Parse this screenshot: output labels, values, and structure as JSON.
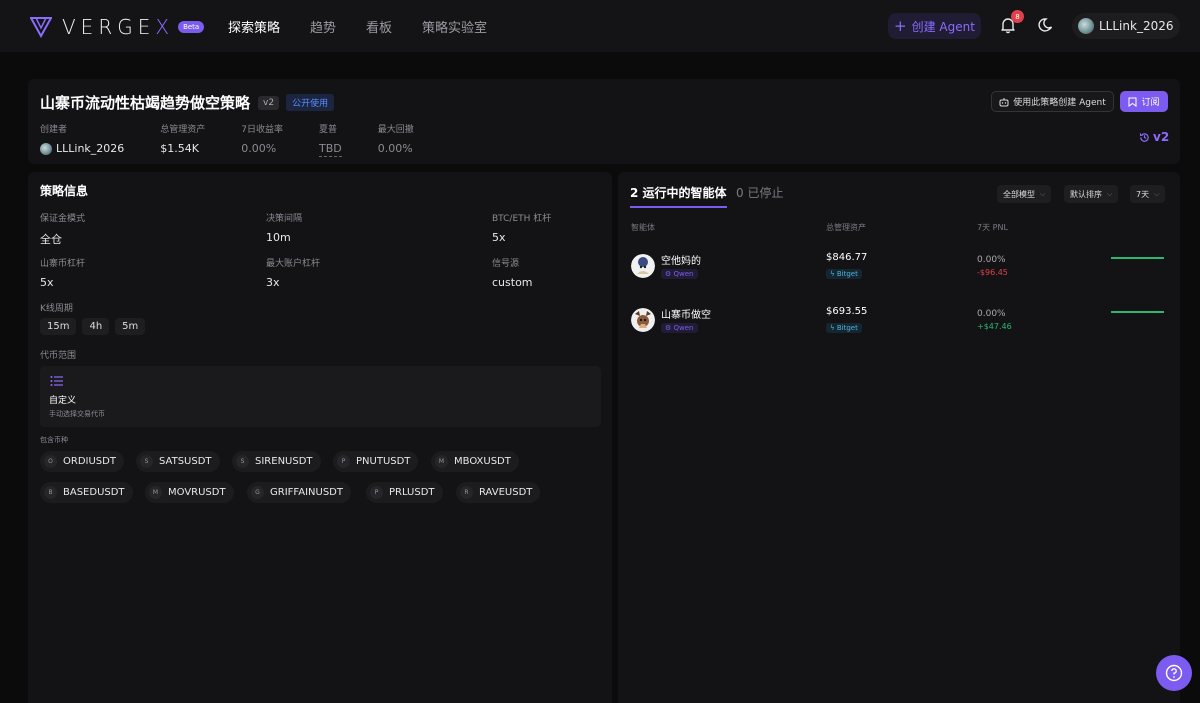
{
  "brand": {
    "name_main": "VERGE",
    "name_accent": "X",
    "beta": "Beta",
    "accent_color": "#7c5cf0"
  },
  "nav": {
    "items": [
      {
        "label": "探索策略",
        "active": true
      },
      {
        "label": "趋势",
        "active": false
      },
      {
        "label": "看板",
        "active": false
      },
      {
        "label": "策略实验室",
        "active": false
      }
    ],
    "create_agent": "创建 Agent",
    "notification_count": "8",
    "username": "LLLink_2026"
  },
  "strategy": {
    "title": "山寨币流动性枯竭趋势做空策略",
    "version": "v2",
    "visibility": "公开使用",
    "stats": [
      {
        "label": "创建者",
        "value": "LLLink_2026"
      },
      {
        "label": "总管理资产",
        "value": "$1.54K"
      },
      {
        "label": "7日收益率",
        "value": "0.00%"
      },
      {
        "label": "夏普",
        "value": "TBD"
      },
      {
        "label": "最大回撤",
        "value": "0.00%"
      }
    ],
    "create_from_button": "使用此策略创建 Agent",
    "subscribe_button": "订阅",
    "version_history": "v2"
  },
  "info": {
    "section_title": "策略信息",
    "fields": [
      {
        "label": "保证金模式",
        "value": "全仓"
      },
      {
        "label": "决策间隔",
        "value": "10m"
      },
      {
        "label": "BTC/ETH 杠杆",
        "value": "5x"
      },
      {
        "label": "山寨币杠杆",
        "value": "5x"
      },
      {
        "label": "最大账户杠杆",
        "value": "3x"
      },
      {
        "label": "信号源",
        "value": "custom"
      }
    ],
    "kline_label": "K线周期",
    "klines": [
      "15m",
      "4h",
      "5m"
    ],
    "coin_range_label": "代币范围",
    "custom_title": "自定义",
    "custom_subtitle": "手动选择交易代币",
    "coins_label": "包含币种",
    "coins": [
      {
        "letter": "O",
        "name": "ORDIUSDT"
      },
      {
        "letter": "S",
        "name": "SATSUSDT"
      },
      {
        "letter": "S",
        "name": "SIRENUSDT"
      },
      {
        "letter": "P",
        "name": "PNUTUSDT"
      },
      {
        "letter": "M",
        "name": "MBOXUSDT"
      },
      {
        "letter": "B",
        "name": "BASEDUSDT"
      },
      {
        "letter": "M",
        "name": "MOVRUSDT"
      },
      {
        "letter": "G",
        "name": "GRIFFAINUSDT"
      },
      {
        "letter": "P",
        "name": "PRLUSDT"
      },
      {
        "letter": "R",
        "name": "RAVEUSDT"
      }
    ]
  },
  "agents": {
    "tab_running": "2 运行中的智能体",
    "tab_stopped": "0 已停止",
    "filters": {
      "model": "全部模型",
      "sort": "默认排序",
      "period": "7天"
    },
    "columns": {
      "agent": "智能体",
      "aum": "总管理资产",
      "pnl": "7天 PNL"
    },
    "rows": [
      {
        "name": "空他妈的",
        "model": "Qwen",
        "aum": "$846.77",
        "exchange": "Bitget",
        "pnl_pct": "0.00%",
        "pnl_abs": "-$96.45",
        "trend": "negative"
      },
      {
        "name": "山寨币做空",
        "model": "Qwen",
        "aum": "$693.55",
        "exchange": "Bitget",
        "pnl_pct": "0.00%",
        "pnl_abs": "+$47.46",
        "trend": "positive"
      }
    ]
  }
}
